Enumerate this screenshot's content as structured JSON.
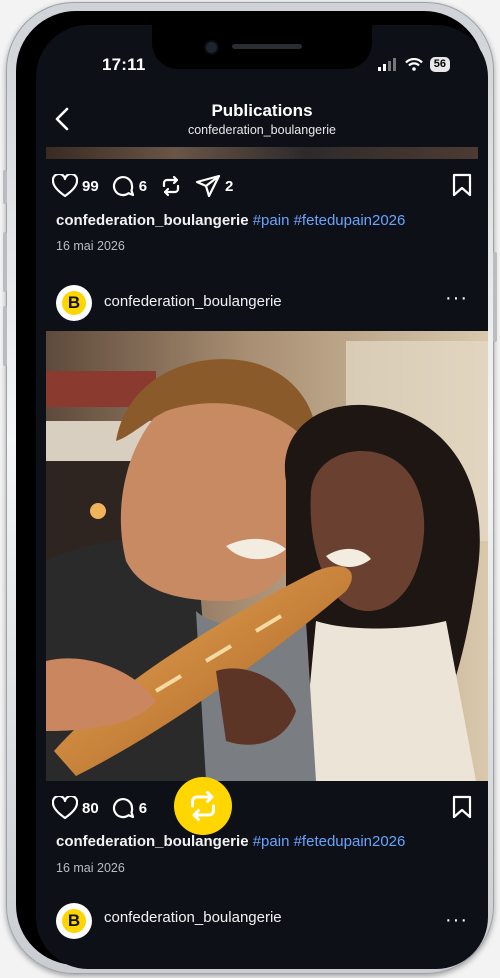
{
  "status_bar": {
    "time": "17:11",
    "battery": "56"
  },
  "header": {
    "title": "Publications",
    "subtitle": "confederation_boulangerie"
  },
  "post1": {
    "likes": "99",
    "comments": "6",
    "shares": "2",
    "caption_user": "confederation_boulangerie",
    "caption_tags": "#pain #fetedupain2026",
    "date": "16 mai 2026"
  },
  "post2": {
    "username": "confederation_boulangerie",
    "avatar_letter": "B",
    "likes": "80",
    "comments": "6",
    "caption_user": "confederation_boulangerie",
    "caption_tags": "#pain #fetedupain2026",
    "date": "16 mai 2026"
  },
  "post3": {
    "username": "confederation_boulangerie",
    "avatar_letter": "B"
  },
  "colors": {
    "background": "#0d1117",
    "hashtag": "#6aa3ff",
    "brand_yellow": "#ffd500"
  }
}
